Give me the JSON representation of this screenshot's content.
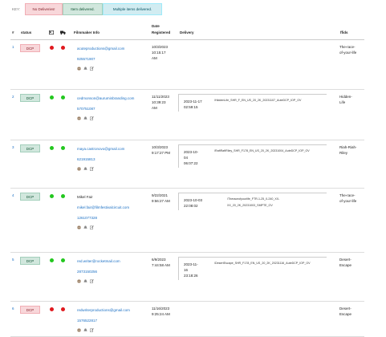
{
  "key": {
    "label": "KEY:",
    "no_deliveries": "No Deliveries!",
    "item_delivered": "Item delivered.",
    "multiple": "Multiple items delivered."
  },
  "headers": {
    "num": "#",
    "status": "status",
    "filmmaker": "Filmmaker Info",
    "date1": "Date",
    "date2": "Registered",
    "delivery": "Delivery",
    "ffid": "ffids"
  },
  "rows": [
    {
      "num": "1",
      "badge": "DCP",
      "status": "red",
      "email": "acuteproductions@gmail.com",
      "phone": "925571907",
      "date": [
        "10/3/2023",
        "10:15:17",
        "AM"
      ],
      "delivery_date": [],
      "delivery_file": [],
      "ffid": [
        "The-race-",
        "of-your-life"
      ]
    },
    {
      "num": "2",
      "badge": "DCP",
      "status": "green",
      "email": "cedmonson@auruminbranding.com",
      "phone": "570751087",
      "date": [
        "11/11/2023",
        "10:39:23",
        "AM"
      ],
      "delivery_date": [
        "2023-11-17",
        "02:59:15"
      ],
      "delivery_file": [
        "/HiddenLife_SHR_F_EN_US_20_2K_20231107_AuteDCP_IOP_OV"
      ],
      "ffid": [
        "Hidden-",
        "Life"
      ]
    },
    {
      "num": "3",
      "badge": "DCP",
      "status": "green",
      "email": "maya.castronovo@gmail.com",
      "phone": "621915813",
      "date": [
        "10/3/2023",
        "9:17:27 PM"
      ],
      "delivery_date": [
        "2023-10-",
        "04",
        "06:07:22"
      ],
      "delivery_file": [
        "/RaftRaftRiley_SHR_F178_EN_US_20_2K_20231004_AuteDCP_IOP_OV"
      ],
      "ffid": [
        "Riah-Riah-",
        "Riley"
      ]
    },
    {
      "num": "4",
      "badge": "DCP",
      "status": "green",
      "name": "Mikel Fair",
      "email": "mikel.fair@filmfestivalcircuit.com",
      "phone": "1261077328",
      "date": [
        "9/22/2021",
        "9:56:27 AM"
      ],
      "delivery_date": [
        "2023-10-03",
        "22:08:02"
      ],
      "delivery_file": [
        "/Theraceofyourlife_FTR-1-25_0-240_XX-",
        "XX_20_2K_20231003_SMPTE_OV"
      ],
      "ffid": [
        "The-race-",
        "of-your-life"
      ]
    },
    {
      "num": "5",
      "badge": "DCP",
      "status": "green",
      "email": "red.writer@rocketmail.com",
      "phone": "2873150256",
      "date": [
        "6/9/2023",
        "7:44:58 AM"
      ],
      "delivery_date": [
        "2023-11-",
        "16",
        "23:18:26"
      ],
      "delivery_file": [
        "/DesertEscape_SHR_F178_EN_US_20_2K_20231116_AuteDCP_IOP_OV"
      ],
      "ffid": [
        "Desert-",
        "Escape"
      ]
    },
    {
      "num": "6",
      "badge": "DCP",
      "status": "red",
      "email": "redwriterproductions@gmail.com",
      "phone": "1576522817",
      "date": [
        "11/16/2023",
        "9:25:24 AM"
      ],
      "delivery_date": [],
      "delivery_file": [],
      "ffid": [
        "Desert-",
        "Escape"
      ]
    }
  ]
}
